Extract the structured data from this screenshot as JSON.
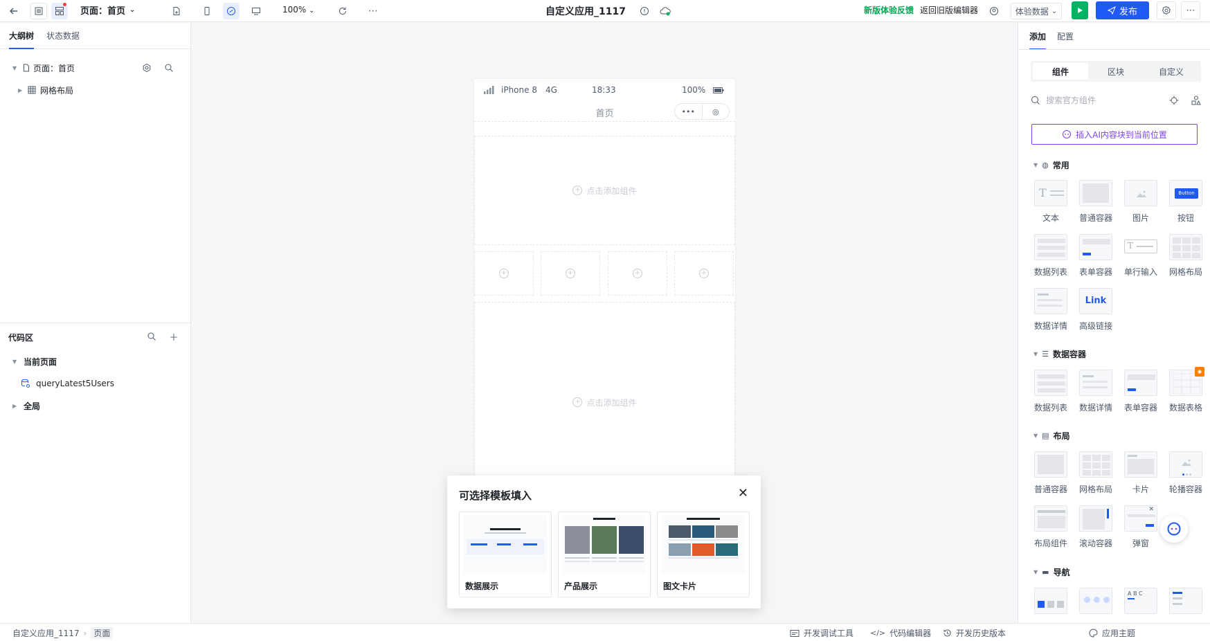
{
  "topbar": {
    "page_select": "页面：首页",
    "zoom": "100%",
    "app_title": "自定义应用_1117",
    "feedback": "新版体验反馈",
    "back_old": "返回旧版编辑器",
    "exp_data": "体验数据",
    "publish": "发布"
  },
  "left": {
    "tabs": [
      "大纲树",
      "状态数据"
    ],
    "tree": {
      "page": "页面：首页",
      "grid": "网格布局"
    },
    "code": {
      "title": "代码区",
      "current": "当前页面",
      "query": "queryLatest5Users",
      "global": "全局"
    }
  },
  "canvas": {
    "status": {
      "carrier": "iPhone 8",
      "network": "4G",
      "time": "18:33",
      "battery": "100%"
    },
    "nav_title": "首页",
    "add_component": "点击添加组件"
  },
  "popup": {
    "title": "可选择模板填入",
    "templates": [
      "数据展示",
      "产品展示",
      "图文卡片"
    ]
  },
  "right": {
    "tabs": [
      "添加",
      "配置"
    ],
    "segments": [
      "组件",
      "区块",
      "自定义"
    ],
    "search_placeholder": "搜索官方组件",
    "ai_insert": "插入AI内容块到当前位置",
    "sections": {
      "common": {
        "title": "常用",
        "items": [
          "文本",
          "普通容器",
          "图片",
          "按钮",
          "数据列表",
          "表单容器",
          "单行输入",
          "网格布局",
          "数据详情",
          "高级链接"
        ]
      },
      "data": {
        "title": "数据容器",
        "items": [
          "数据列表",
          "数据详情",
          "表单容器",
          "数据表格"
        ]
      },
      "layout": {
        "title": "布局",
        "items": [
          "普通容器",
          "网格布局",
          "卡片",
          "轮播容器",
          "布局组件",
          "滚动容器",
          "弹窗"
        ]
      },
      "nav": {
        "title": "导航"
      }
    },
    "thumb_texts": {
      "button": "Button",
      "link": "Link",
      "tabs": "A B C"
    }
  },
  "footer": {
    "breadcrumb": [
      "自定义应用_1117",
      "页面"
    ],
    "debug": "开发调试工具",
    "code_editor": "代码编辑器",
    "history": "开发历史版本",
    "theme": "应用主题"
  }
}
